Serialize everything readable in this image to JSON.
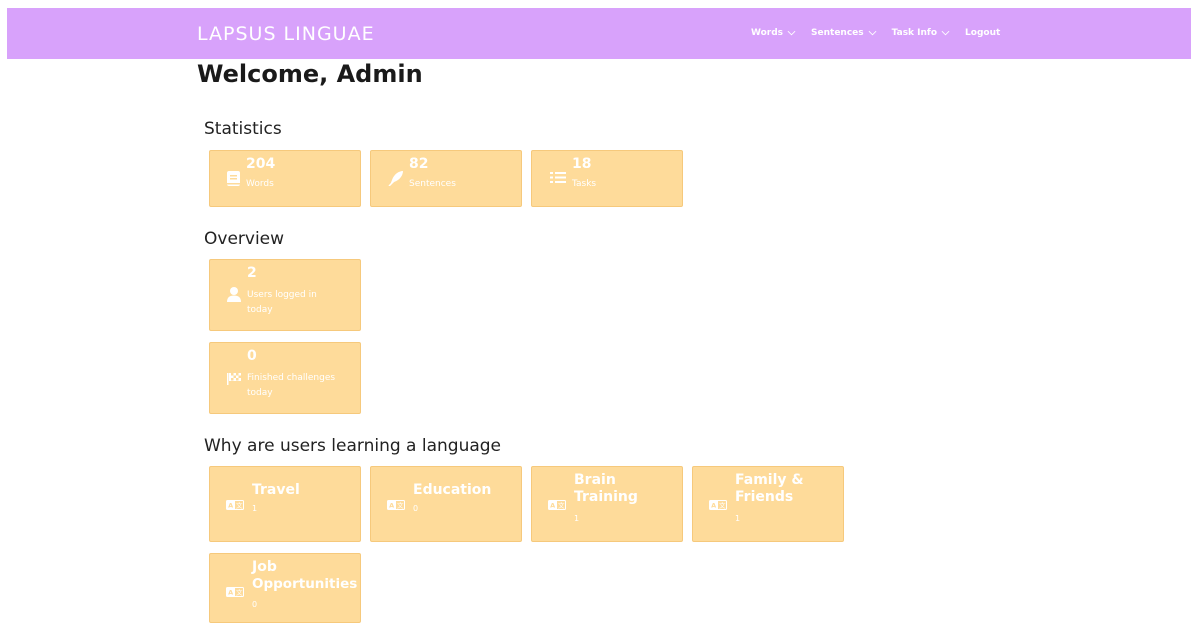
{
  "navbar": {
    "brand": "LAPSUS LINGUAE",
    "links": [
      {
        "label": "Words"
      },
      {
        "label": "Sentences"
      },
      {
        "label": "Task Info"
      },
      {
        "label": "Logout"
      }
    ]
  },
  "welcome": "Welcome, Admin",
  "statistics": {
    "title": "Statistics",
    "items": [
      {
        "value": "204",
        "label": "Words",
        "icon": "book-icon"
      },
      {
        "value": "82",
        "label": "Sentences",
        "icon": "feather-icon"
      },
      {
        "value": "18",
        "label": "Tasks",
        "icon": "list-icon"
      }
    ]
  },
  "overview": {
    "title": "Overview",
    "items": [
      {
        "value": "2",
        "label_line1": "Users logged in",
        "label_line2": "today",
        "icon": "user-icon"
      },
      {
        "value": "0",
        "label_line1": "Finished challenges",
        "label_line2": "today",
        "icon": "checkered-flag-icon"
      }
    ]
  },
  "reasons": {
    "title": "Why are users learning a language",
    "items": [
      {
        "line1": "Travel",
        "line2": "",
        "count": "1",
        "icon": "language-icon"
      },
      {
        "line1": "Education",
        "line2": "",
        "count": "0",
        "icon": "language-icon"
      },
      {
        "line1": "Brain",
        "line2": "Training",
        "count": "1",
        "icon": "language-icon"
      },
      {
        "line1": "Family &",
        "line2": "Friends",
        "count": "1",
        "icon": "language-icon"
      },
      {
        "line1": "Job",
        "line2": "Opportunities",
        "count": "0",
        "icon": "language-icon"
      }
    ]
  },
  "colors": {
    "navbar": "#d8a2fb",
    "card": "#fedb9a",
    "card_border": "#f6c97c"
  }
}
